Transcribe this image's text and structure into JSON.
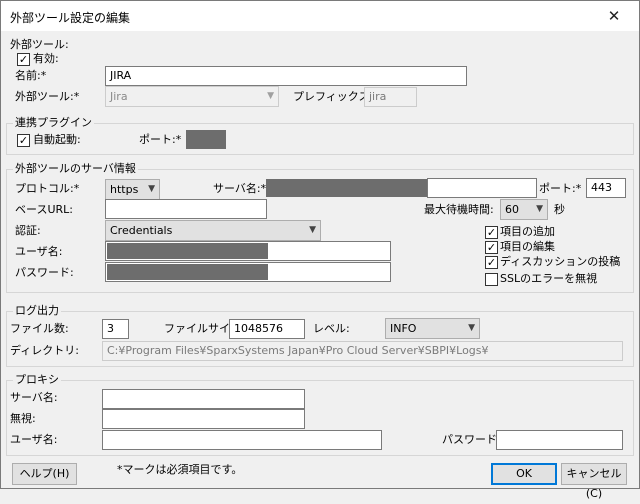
{
  "window": {
    "title": "外部ツール設定の編集",
    "close_glyph": "✕"
  },
  "external_tool": {
    "section_label": "外部ツール:",
    "enabled_label": "有効:",
    "enabled_checked": true,
    "name_label": "名前:*",
    "name_value": "JIRA",
    "tool_label": "外部ツール:*",
    "tool_value": "Jira",
    "prefix_label": "プレフィックス:*",
    "prefix_value": "jira"
  },
  "plugin": {
    "group_label": "連携プラグイン",
    "autostart_label": "自動起動:",
    "autostart_checked": true,
    "port_label": "ポート:*"
  },
  "server": {
    "group_label": "外部ツールのサーバ情報",
    "protocol_label": "プロトコル:*",
    "protocol_value": "https",
    "server_label": "サーバ名:*",
    "port_label": "ポート:*",
    "port_value": "443",
    "baseurl_label": "ベースURL:",
    "baseurl_value": "",
    "wait_label": "最大待機時間:",
    "wait_value": "60",
    "wait_unit": "秒",
    "auth_label": "認証:",
    "auth_value": "Credentials",
    "user_label": "ユーザ名:",
    "password_label": "パスワード:",
    "checkboxes": [
      {
        "label": "項目の追加",
        "checked": true
      },
      {
        "label": "項目の編集",
        "checked": true
      },
      {
        "label": "ディスカッションの投稿",
        "checked": true
      },
      {
        "label": "SSLのエラーを無視",
        "checked": false
      }
    ]
  },
  "log": {
    "group_label": "ログ出力",
    "files_label": "ファイル数:",
    "files_value": "3",
    "filesize_label": "ファイルサイズ:",
    "filesize_value": "1048576",
    "level_label": "レベル:",
    "level_value": "INFO",
    "dir_label": "ディレクトリ:",
    "dir_value": "C:¥Program Files¥SparxSystems Japan¥Pro Cloud Server¥SBPI¥Logs¥"
  },
  "proxy": {
    "group_label": "プロキシ",
    "server_label": "サーバ名:",
    "server_value": "",
    "ignore_label": "無視:",
    "ignore_value": "",
    "user_label": "ユーザ名:",
    "user_value": "",
    "password_label": "パスワード:",
    "password_value": ""
  },
  "footer": {
    "help_label": "ヘルプ(H)",
    "note": "*マークは必須項目です。",
    "ok_label": "OK",
    "cancel_label": "キャンセル(C)"
  },
  "icons": {
    "checkmark": "✓",
    "dropdown": "▼"
  }
}
